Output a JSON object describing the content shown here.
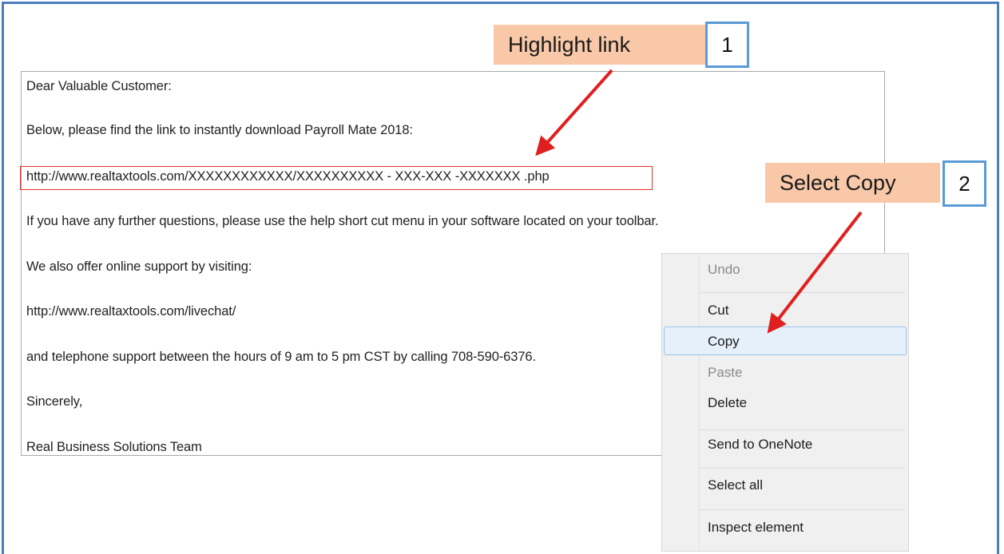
{
  "email": {
    "greeting": "Dear Valuable Customer:",
    "intro": "Below, please find the link to instantly download Payroll Mate 2018:",
    "download_link": "http://www.realtaxtools.com/XXXXXXXXXXXX/XXXXXXXXXX - XXX-XXX -XXXXXXX .php",
    "questions": "If you have any further questions, please use the help short cut menu in your software located on your toolbar.",
    "support_intro": "We also offer online support by visiting:",
    "livechat_link": "http://www.realtaxtools.com/livechat/",
    "phone_line": "and telephone support between the hours of 9 am to 5 pm CST by calling 708-590-6376.",
    "closing": "Sincerely,",
    "signature": "Real Business Solutions Team"
  },
  "annotations": {
    "step1_label": "Highlight link",
    "step1_number": "1",
    "step2_label": "Select Copy",
    "step2_number": "2",
    "callout_color": "#f8c8a8",
    "badge_border_color": "#5b9bd5",
    "arrow_color": "#e02020"
  },
  "context_menu": {
    "items": [
      {
        "label": "Undo",
        "enabled": false
      },
      {
        "label": "Cut",
        "enabled": true
      },
      {
        "label": "Copy",
        "enabled": true,
        "highlighted": true
      },
      {
        "label": "Paste",
        "enabled": false
      },
      {
        "label": "Delete",
        "enabled": true
      },
      {
        "label": "Send to OneNote",
        "enabled": true
      },
      {
        "label": "Select all",
        "enabled": true
      },
      {
        "label": "Inspect element",
        "enabled": true
      }
    ]
  }
}
